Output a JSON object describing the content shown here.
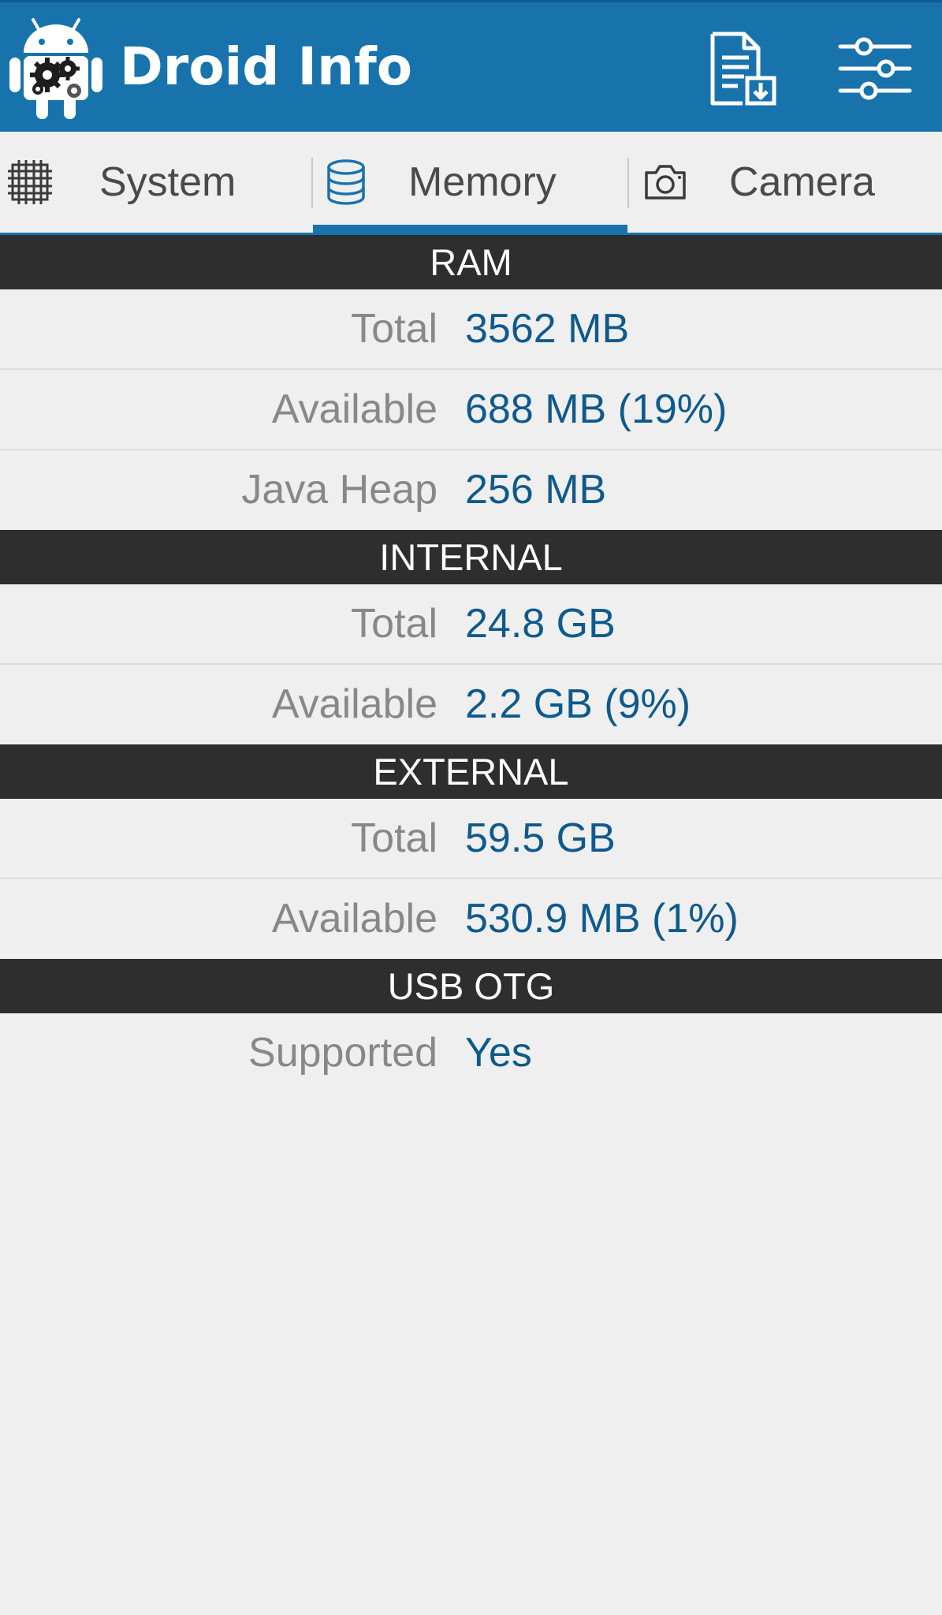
{
  "app": {
    "title": "Droid Info"
  },
  "actions": {
    "export_icon": "export-report-icon",
    "settings_icon": "settings-sliders-icon"
  },
  "tabs": [
    {
      "label": "System",
      "icon": "cpu-chip-icon",
      "active": false
    },
    {
      "label": "Memory",
      "icon": "database-icon",
      "active": true
    },
    {
      "label": "Camera",
      "icon": "camera-icon",
      "active": false
    }
  ],
  "colors": {
    "appbar": "#1873ad",
    "section_header": "#2e2e2e",
    "value_text": "#0f5a8c",
    "label_text": "#888888",
    "background": "#efefef"
  },
  "sections": {
    "ram": {
      "title": "RAM",
      "rows": [
        {
          "label": "Total",
          "value": "3562 MB"
        },
        {
          "label": "Available",
          "value": "688 MB (19%)"
        },
        {
          "label": "Java Heap",
          "value": "256 MB"
        }
      ]
    },
    "internal": {
      "title": "INTERNAL",
      "rows": [
        {
          "label": "Total",
          "value": "24.8 GB"
        },
        {
          "label": "Available",
          "value": "2.2 GB (9%)"
        }
      ]
    },
    "external": {
      "title": "EXTERNAL",
      "rows": [
        {
          "label": "Total",
          "value": "59.5 GB"
        },
        {
          "label": "Available",
          "value": "530.9 MB (1%)"
        }
      ]
    },
    "usb_otg": {
      "title": "USB OTG",
      "rows": [
        {
          "label": "Supported",
          "value": "Yes"
        }
      ]
    }
  }
}
